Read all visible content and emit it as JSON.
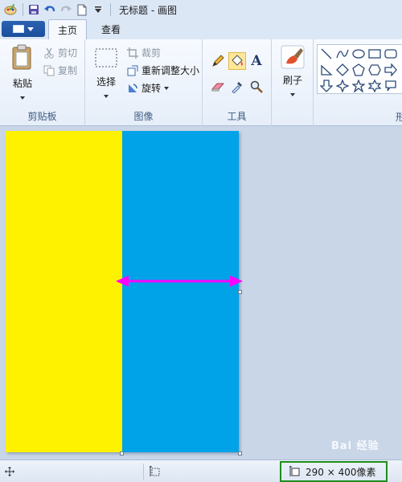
{
  "window": {
    "title": "无标题 - 画图"
  },
  "tabs": {
    "file_label": "",
    "home": "主页",
    "view": "查看"
  },
  "clipboard": {
    "paste": "粘贴",
    "cut": "剪切",
    "copy": "复制",
    "group_label": "剪贴板"
  },
  "image": {
    "select": "选择",
    "crop": "裁剪",
    "resize": "重新调整大小",
    "rotate": "旋转",
    "group_label": "图像"
  },
  "tools": {
    "group_label": "工具",
    "text_glyph": "A"
  },
  "brushes": {
    "label": "刷子"
  },
  "shapes": {
    "label": "形"
  },
  "canvas": {
    "left_color": "#fff200",
    "right_color": "#00a2e8",
    "arrow_color": "#ff00ff"
  },
  "status": {
    "canvas_size": "290 × 400像素"
  },
  "watermark": "Bai 经验"
}
